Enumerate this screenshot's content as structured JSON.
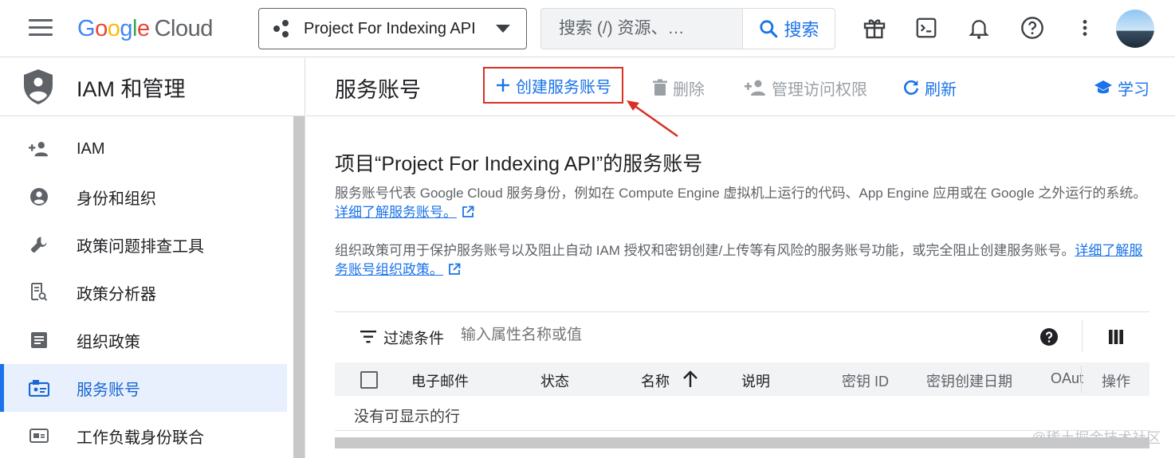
{
  "header": {
    "logo": {
      "G": "G",
      "o1": "o",
      "o2": "o",
      "g": "g",
      "l": "l",
      "e": "e",
      "cloud": "Cloud"
    },
    "project": "Project For Indexing API",
    "search": {
      "placeholder": "搜索 (/) 资源、…",
      "button": "搜索"
    },
    "icons": [
      "gift-icon",
      "terminal-icon",
      "bell-icon",
      "help-icon",
      "more-vert-icon"
    ]
  },
  "sidebar": {
    "title": "IAM 和管理",
    "items": [
      {
        "label": "IAM",
        "icon": "person-add-icon"
      },
      {
        "label": "身份和组织",
        "icon": "account-circle-icon"
      },
      {
        "label": "政策问题排查工具",
        "icon": "wrench-icon"
      },
      {
        "label": "政策分析器",
        "icon": "document-search-icon"
      },
      {
        "label": "组织政策",
        "icon": "list-document-icon"
      },
      {
        "label": "服务账号",
        "icon": "service-account-icon",
        "active": true
      },
      {
        "label": "工作负载身份联合",
        "icon": "id-card-icon"
      }
    ]
  },
  "main": {
    "title": "服务账号",
    "actions": {
      "create": "创建服务账号",
      "delete": "删除",
      "manage": "管理访问权限",
      "refresh": "刷新",
      "learn": "学习"
    },
    "content_title": "项目“Project For Indexing API”的服务账号",
    "desc1": "服务账号代表 Google Cloud 服务身份，例如在 Compute Engine 虚拟机上运行的代码、App Engine 应用或在 Google 之外运行的系统。",
    "desc1_link": "详细了解服务账号。",
    "desc2": "组织政策可用于保护服务账号以及阻止自动 IAM 授权和密钥创建/上传等有风险的服务账号功能，或完全阻止创建服务账号。",
    "desc2_link": "详细了解服务账号组织政策。",
    "filter": {
      "label": "过滤条件",
      "placeholder": "输入属性名称或值"
    },
    "columns": [
      "电子邮件",
      "状态",
      "名称",
      "说明",
      "密钥 ID",
      "密钥创建日期",
      "OAut",
      "操作"
    ],
    "empty": "没有可显示的行"
  },
  "watermark": "@稀土掘金技术社区",
  "colors": {
    "accent": "#1a73e8",
    "highlight": "#d93025",
    "active_bg": "#e8f0fe"
  }
}
